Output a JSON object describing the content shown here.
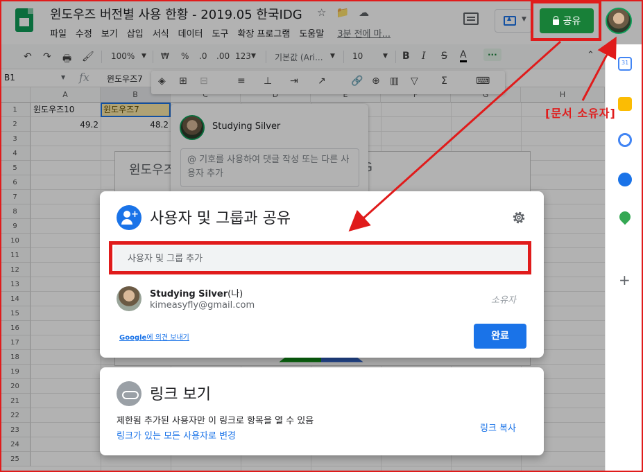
{
  "header": {
    "doc_title": "윈도우즈 버전별 사용 한황 - 2019.05 한국IDG",
    "star_icon": "star-icon",
    "menu": [
      "파일",
      "수정",
      "보기",
      "삽입",
      "서식",
      "데이터",
      "도구",
      "확장 프로그램",
      "도움말"
    ],
    "last_edit": "3분 전에 마...",
    "share_label": "공유"
  },
  "toolbar": {
    "zoom": "100%",
    "currency": "₩",
    "percent": "%",
    "dec_less": ".0",
    "dec_more": ".00",
    "format_num": "123",
    "font": "기본값 (Ari...",
    "font_size": "10",
    "bold": "B",
    "italic": "I",
    "strike": "S",
    "color": "A",
    "more": "···"
  },
  "formula": {
    "cell_ref": "B1",
    "fx": "fx",
    "value": "윈도우즈7"
  },
  "sheet": {
    "columns": [
      "A",
      "B",
      "C",
      "D",
      "E",
      "F",
      "G",
      "H"
    ],
    "rows": [
      "1",
      "2",
      "3",
      "4",
      "5",
      "6",
      "7",
      "8",
      "9",
      "10",
      "11",
      "12",
      "13",
      "14",
      "15",
      "16",
      "17",
      "18",
      "19",
      "20",
      "21",
      "22",
      "23",
      "24",
      "25"
    ],
    "a1": "윈도우즈10",
    "b1": "윈도우즈7",
    "a2": "49.2",
    "b2": "48.2",
    "chart_title_left": "윈도우즈",
    "chart_title_right": "G"
  },
  "comment": {
    "name": "Studying Silver",
    "placeholder": "@ 기호를 사용하여 댓글 작성 또는 다른 사용자 추가"
  },
  "share_dialog": {
    "title": "사용자 및 그룹과 공유",
    "add_placeholder": "사용자 및 그룹 추가",
    "owner_name": "Studying Silver",
    "owner_suffix": "(나)",
    "owner_email": "kimeasyfly@gmail.com",
    "owner_role": "소유자",
    "feedback_google": "Google",
    "feedback_rest": "에 의견 보내기",
    "done": "완료"
  },
  "link_dialog": {
    "title": "링크 보기",
    "description": "제한됨 추가된 사용자만 이 링크로 항목을 열 수 있음",
    "change": "링크가 있는 모든 사용자로 변경",
    "copy": "링크 복사"
  },
  "annotation": {
    "label": "[문서 소유자]"
  },
  "colors": {
    "share_green": "#188038",
    "accent_blue": "#1a73e8",
    "annotation_red": "#e01b1b"
  }
}
